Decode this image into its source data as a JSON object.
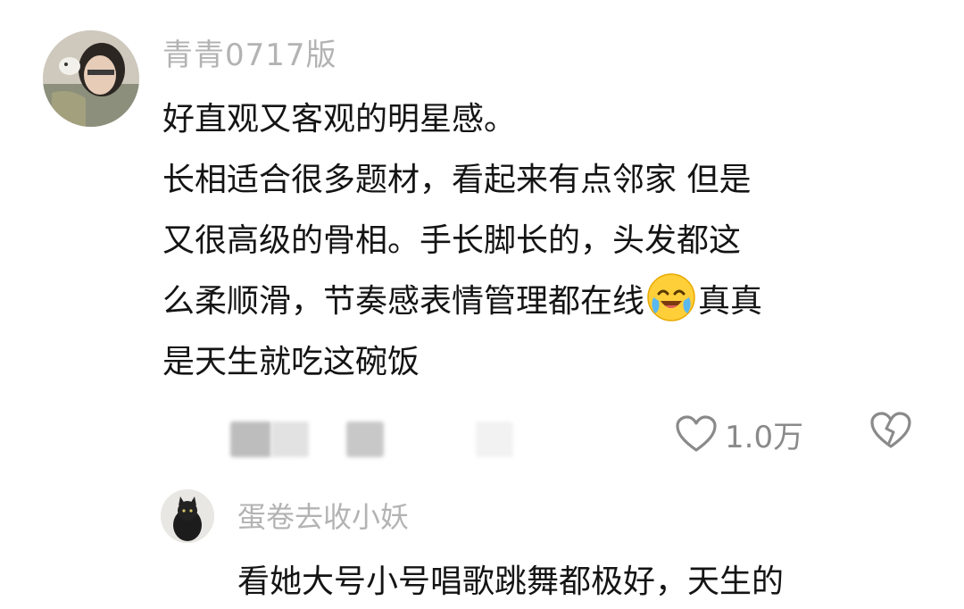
{
  "comment": {
    "username": "青青0717版",
    "lines": [
      "好直观又客观的明星感。",
      "长相适合很多题材，看起来有点邻家 但是",
      "又很高级的骨相。手长脚长的，头发都这"
    ],
    "line4_before_emoji": "么柔顺滑，节奏感表情管理都在线",
    "line4_after_emoji": "真真",
    "line5": "是天生就吃这碗饭",
    "emoji_icon": "crying-laughing-face-icon",
    "like_count": "1.0万",
    "colors": {
      "username": "#b3b3b3",
      "text": "#141414",
      "meta": "#8a8a8a"
    }
  },
  "reply": {
    "username": "蛋卷去收小妖",
    "text": "看她大号小号唱歌跳舞都极好，天生的"
  }
}
